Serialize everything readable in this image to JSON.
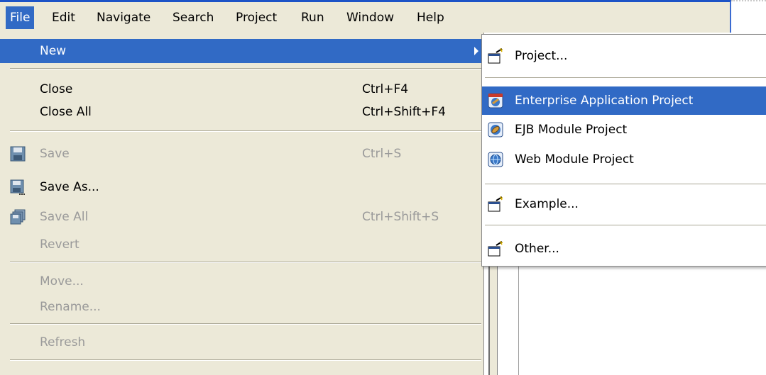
{
  "menubar": {
    "items": [
      "File",
      "Edit",
      "Navigate",
      "Search",
      "Project",
      "Run",
      "Window",
      "Help"
    ]
  },
  "file_menu": {
    "new": {
      "label": "New"
    },
    "close": {
      "label": "Close",
      "accel": "Ctrl+F4"
    },
    "close_all": {
      "label": "Close All",
      "accel": "Ctrl+Shift+F4"
    },
    "save": {
      "label": "Save",
      "accel": "Ctrl+S"
    },
    "save_as": {
      "label": "Save As..."
    },
    "save_all": {
      "label": "Save All",
      "accel": "Ctrl+Shift+S"
    },
    "revert": {
      "label": "Revert"
    },
    "move": {
      "label": "Move..."
    },
    "rename": {
      "label": "Rename..."
    },
    "refresh": {
      "label": "Refresh"
    }
  },
  "new_submenu": {
    "project": "Project...",
    "enterprise_app": "Enterprise Application Project",
    "ejb_module": "EJB Module Project",
    "web_module": "Web Module Project",
    "example": "Example...",
    "other": "Other..."
  },
  "colors": {
    "highlight": "#316ac5",
    "menu_bg": "#ece9d8",
    "disabled_text": "#9a9a9a"
  }
}
